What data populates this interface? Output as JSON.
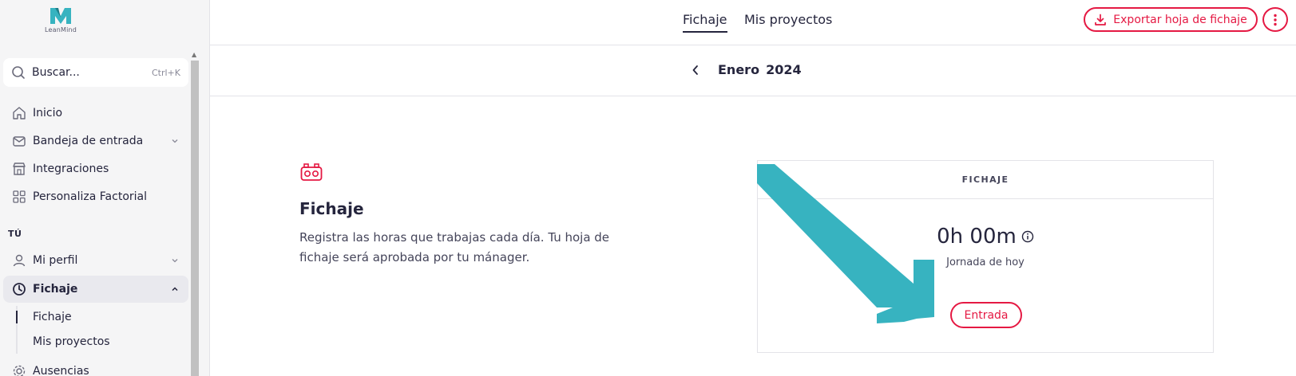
{
  "sidebar": {
    "logo_text": "LeanMind",
    "search": {
      "placeholder": "Buscar...",
      "shortcut": "Ctrl+K"
    },
    "items": [
      {
        "label": "Inicio",
        "icon": "home-icon"
      },
      {
        "label": "Bandeja de entrada",
        "icon": "inbox-icon",
        "expandable": true
      },
      {
        "label": "Integraciones",
        "icon": "store-icon"
      },
      {
        "label": "Personaliza Factorial",
        "icon": "grid-icon"
      }
    ],
    "section_title": "TÚ",
    "section_items": [
      {
        "label": "Mi perfil",
        "icon": "user-icon",
        "expandable": true
      },
      {
        "label": "Fichaje",
        "icon": "clock-icon",
        "expanded": true,
        "active": true
      }
    ],
    "sub_items": [
      {
        "label": "Fichaje",
        "active": true
      },
      {
        "label": "Mis proyectos",
        "active": false
      }
    ],
    "bottom_item": {
      "label": "Ausencias",
      "icon": "gear-icon"
    }
  },
  "topbar": {
    "tabs": [
      {
        "label": "Fichaje",
        "active": true
      },
      {
        "label": "Mis proyectos",
        "active": false
      }
    ],
    "export_label": "Exportar hoja de fichaje"
  },
  "month_nav": {
    "month": "Enero",
    "year": "2024"
  },
  "intro": {
    "title": "Fichaje",
    "description": "Registra las horas que trabajas cada día. Tu hoja de fichaje será aprobada por tu mánager."
  },
  "card": {
    "header": "FICHAJE",
    "time_value": "0h 00m",
    "time_caption": "Jornada de hoy",
    "entrada_label": "Entrada"
  },
  "colors": {
    "accent": "#e51943",
    "annotation_arrow": "#37b3c0",
    "text": "#25253d"
  }
}
